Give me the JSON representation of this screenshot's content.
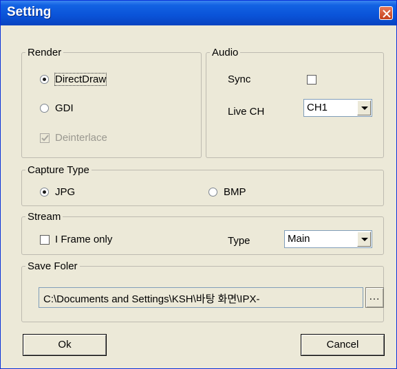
{
  "window": {
    "title": "Setting"
  },
  "render": {
    "legend": "Render",
    "directdraw_label": "DirectDraw",
    "directdraw_selected": true,
    "gdi_label": "GDI",
    "gdi_selected": false,
    "deinterlace_label": "Deinterlace",
    "deinterlace_checked": true,
    "deinterlace_enabled": false
  },
  "audio": {
    "legend": "Audio",
    "sync_label": "Sync",
    "sync_checked": false,
    "live_ch_label": "Live CH",
    "live_ch_value": "CH1"
  },
  "capture": {
    "legend": "Capture Type",
    "jpg_label": "JPG",
    "jpg_selected": true,
    "bmp_label": "BMP",
    "bmp_selected": false
  },
  "stream": {
    "legend": "Stream",
    "iframe_label": "I Frame only",
    "iframe_checked": false,
    "type_label": "Type",
    "type_value": "Main"
  },
  "save": {
    "legend": "Save Foler",
    "path": "C:\\Documents and Settings\\KSH\\바탕 화면\\IPX-",
    "browse_label": "..."
  },
  "buttons": {
    "ok": "Ok",
    "cancel": "Cancel"
  },
  "colors": {
    "titlebar": "#0a53d8",
    "dialog_bg": "#ece9d8",
    "close": "#c4401c"
  }
}
